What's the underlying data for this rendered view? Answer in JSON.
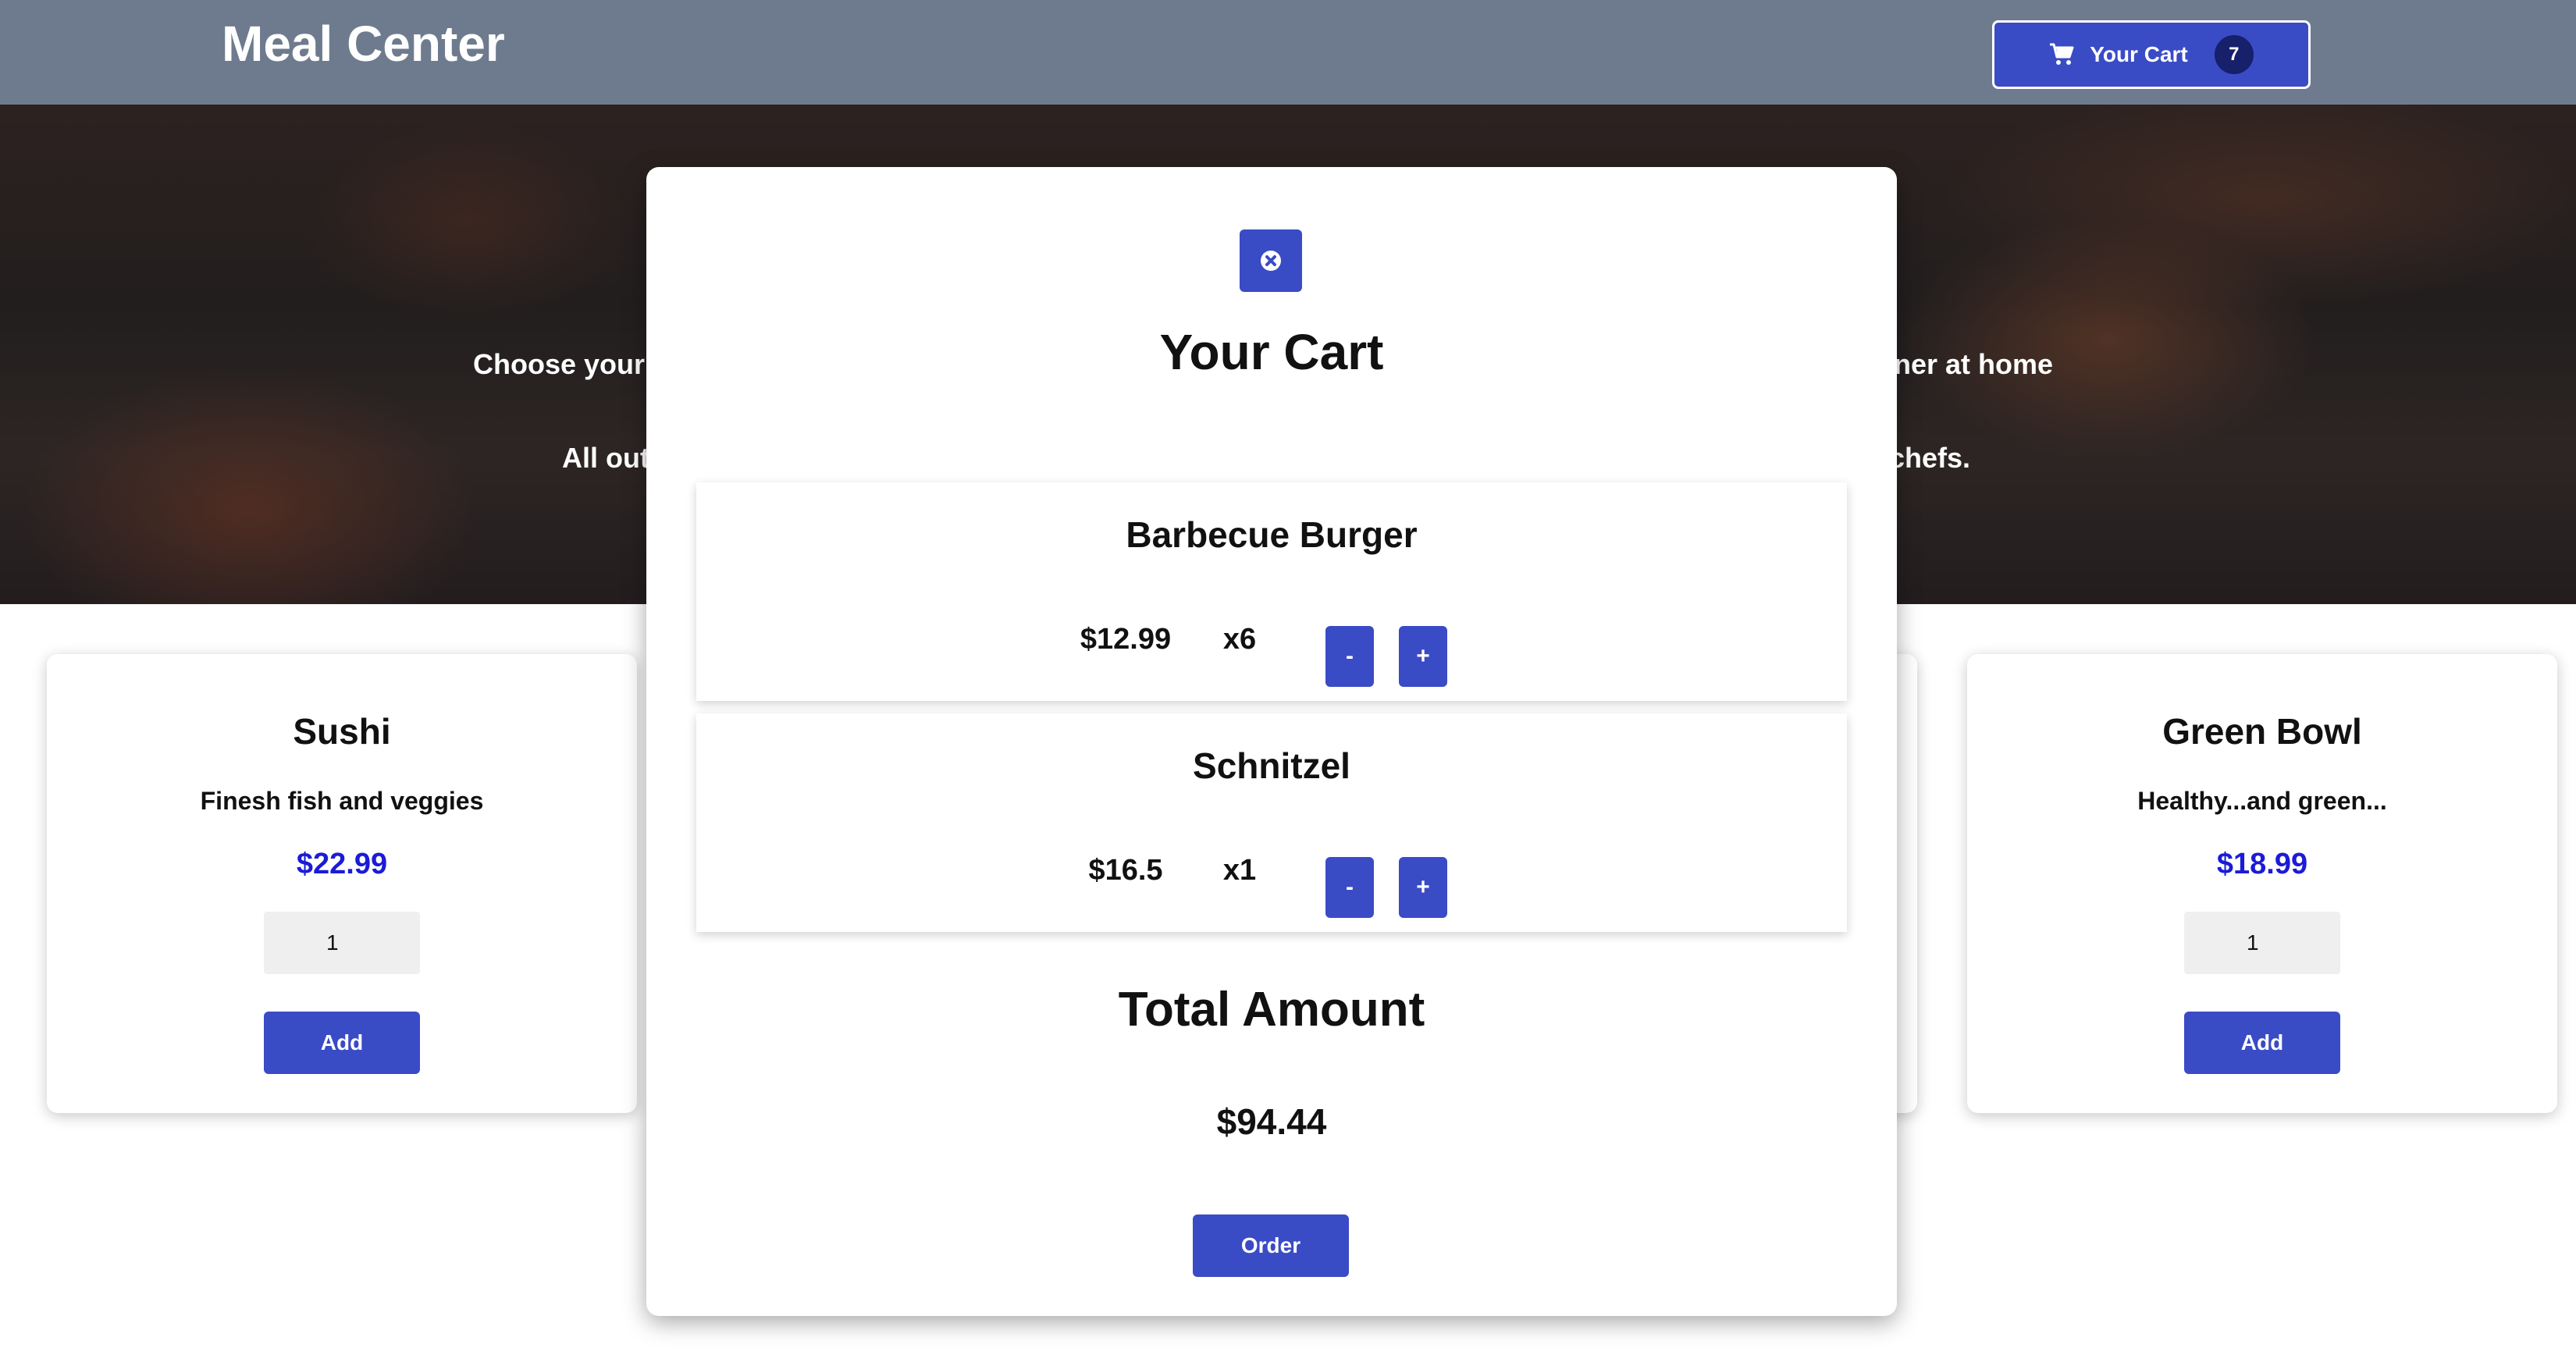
{
  "header": {
    "title": "Meal Center",
    "cart_button": {
      "label": "Your Cart",
      "count": "7",
      "icon": "cart-icon"
    }
  },
  "hero": {
    "line1_left": "Choose your",
    "line1_right": "nner at home",
    "line2_left": "All out",
    "line2_right": "chefs."
  },
  "meals": [
    {
      "name": "Sushi",
      "description": "Finesh fish and veggies",
      "price": "$22.99",
      "quantity": "1",
      "add_label": "Add"
    },
    {
      "name": "Green Bowl",
      "description": "Healthy...and green...",
      "price": "$18.99",
      "quantity": "1",
      "add_label": "Add"
    }
  ],
  "cart_modal": {
    "close_icon": "close-icon",
    "title": "Your Cart",
    "items": [
      {
        "name": "Barbecue Burger",
        "price": "$12.99",
        "quantity": "x6",
        "minus": "-",
        "plus": "+"
      },
      {
        "name": "Schnitzel",
        "price": "$16.5",
        "quantity": "x1",
        "minus": "-",
        "plus": "+"
      }
    ],
    "total_label": "Total Amount",
    "total_value": "$94.44",
    "order_label": "Order"
  },
  "colors": {
    "accent": "#3a4bc6",
    "header_bg": "#6e7b8e",
    "price": "#1b1bd6",
    "badge": "#16206b"
  }
}
